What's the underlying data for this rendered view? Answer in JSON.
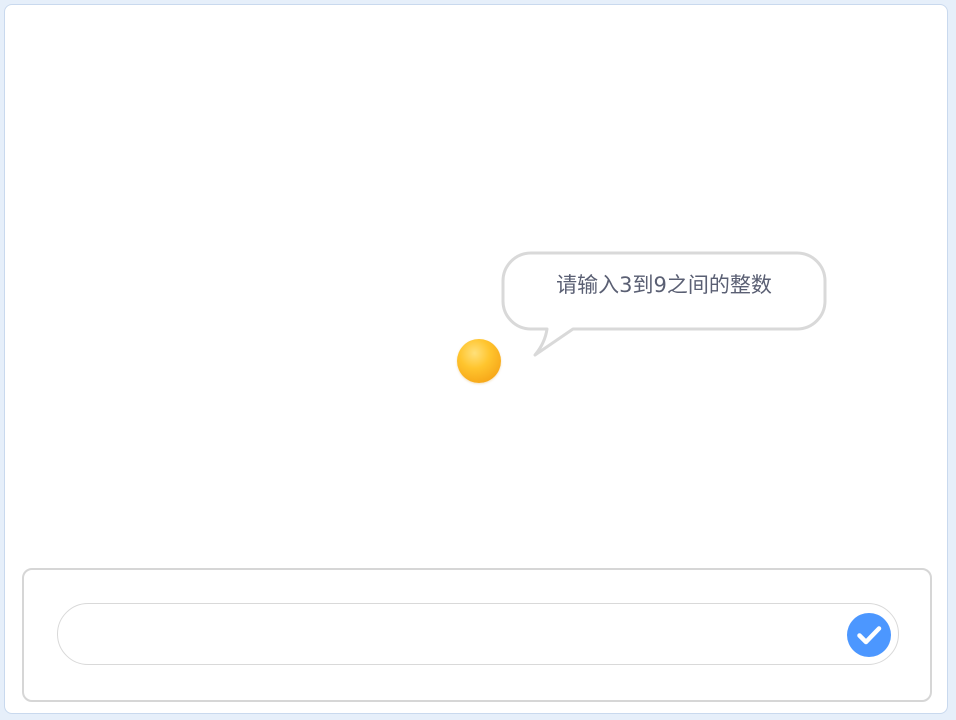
{
  "stage": {
    "speech_bubble": {
      "text": "请输入3到9之间的整数"
    },
    "sprite": {
      "icon": "yellow-ball-sprite"
    }
  },
  "ask_prompt": {
    "input_value": "",
    "submit_icon": "check-circle-icon"
  },
  "colors": {
    "accent": "#4c97ff",
    "sprite": "#ffc52e",
    "bubble_border": "#d9d9d9",
    "bubble_text": "#5a5f73"
  }
}
